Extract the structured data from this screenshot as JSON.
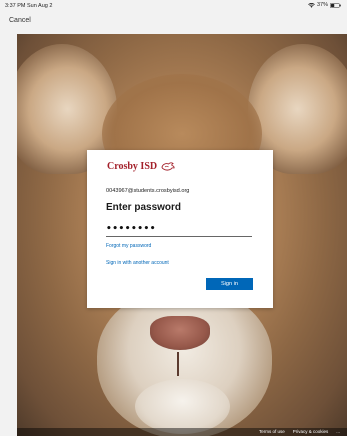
{
  "status_bar": {
    "time": "3:37 PM  Sun Aug 2",
    "battery": "37%"
  },
  "header": {
    "cancel_label": "Cancel"
  },
  "dialog": {
    "brand_name": "Crosby ISD",
    "account_email": "0043967@students.crosbyisd.org",
    "title": "Enter password",
    "password_value": "••••••••",
    "forgot_password_label": "Forgot my password",
    "other_account_label": "Sign in with another account",
    "sign_in_label": "Sign in"
  },
  "footer": {
    "terms_label": "Terms of use",
    "privacy_label": "Privacy & cookies",
    "more_label": "..."
  },
  "colors": {
    "brand": "#a3202a",
    "accent": "#0067b8"
  },
  "icons": {
    "wifi": "wifi-icon",
    "battery": "battery-icon",
    "logo": "cougar-logo-icon"
  }
}
